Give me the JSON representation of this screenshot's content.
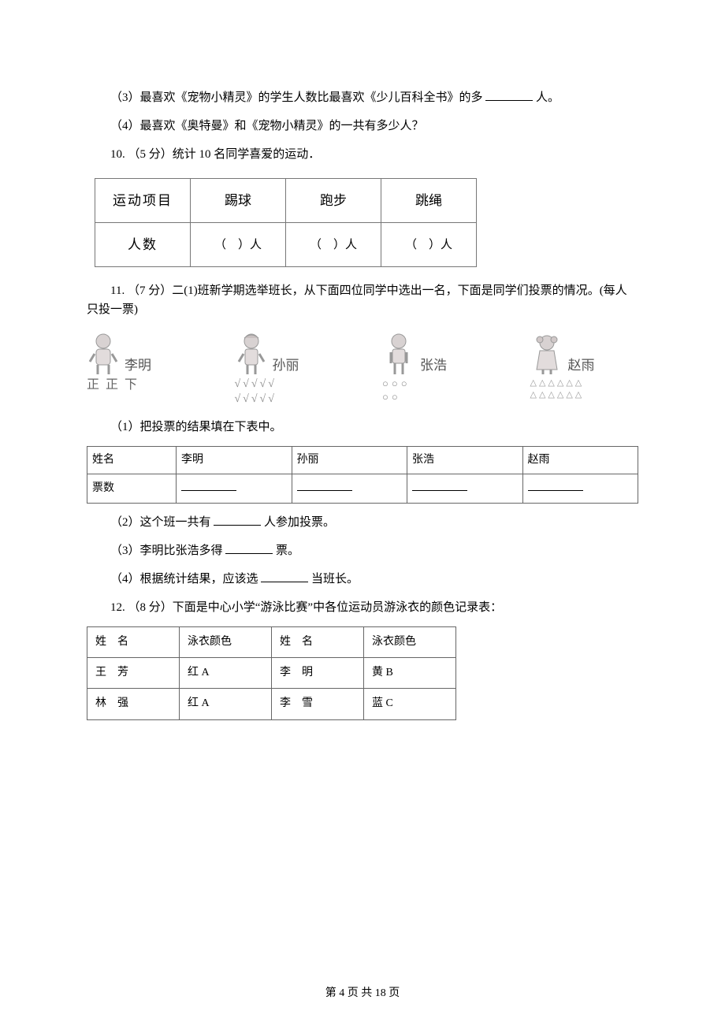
{
  "q9": {
    "p3": "（3）最喜欢《宠物小精灵》的学生人数比最喜欢《少儿百科全书》的多",
    "p3_suffix": "人。",
    "p4": "（4）最喜欢《奥特曼》和《宠物小精灵》的一共有多少人？"
  },
  "q10": {
    "stem_label": "10. （5 分）统计 10 名同学喜爱的运动．",
    "row1_label": "运动项目",
    "cols": [
      "踢球",
      "跑步",
      "跳绳"
    ],
    "row2_label": "人数",
    "cell_template_l": "（",
    "cell_template_r": "）人"
  },
  "q11": {
    "stem": "11. （7 分）二(1)班新学期选举班长，从下面四位同学中选出一名，下面是同学们投票的情况。(每人只投一票)",
    "candidates": [
      {
        "name": "李明",
        "marks": "正 正 下"
      },
      {
        "name": "孙丽",
        "marks": "√√√√√\n√√√√√"
      },
      {
        "name": "张浩",
        "marks": "○○○\n○○"
      },
      {
        "name": "赵雨",
        "marks": "△△△△△△\n△△△△△△"
      }
    ],
    "sub1": "（1）把投票的结果填在下表中。",
    "table": {
      "header_label": "姓名",
      "names": [
        "李明",
        "孙丽",
        "张浩",
        "赵雨"
      ],
      "row2_label": "票数"
    },
    "sub2_pre": "（2）这个班一共有",
    "sub2_suf": "人参加投票。",
    "sub3_pre": "（3）李明比张浩多得",
    "sub3_suf": "票。",
    "sub4_pre": "（4）根据统计结果，应该选",
    "sub4_suf": "当班长。"
  },
  "q12": {
    "stem": "12. （8 分）下面是中心小学“游泳比赛”中各位运动员游泳衣的颜色记录表：",
    "headers": {
      "name": "姓　名",
      "color": "泳衣颜色"
    },
    "rows": [
      {
        "n1": "王　芳",
        "c1": "红 A",
        "n2": "李　明",
        "c2": "黄 B"
      },
      {
        "n1": "林　强",
        "c1": "红 A",
        "n2": "李　雪",
        "c2": "蓝 C"
      }
    ]
  },
  "footer": "第 4 页 共 18 页"
}
